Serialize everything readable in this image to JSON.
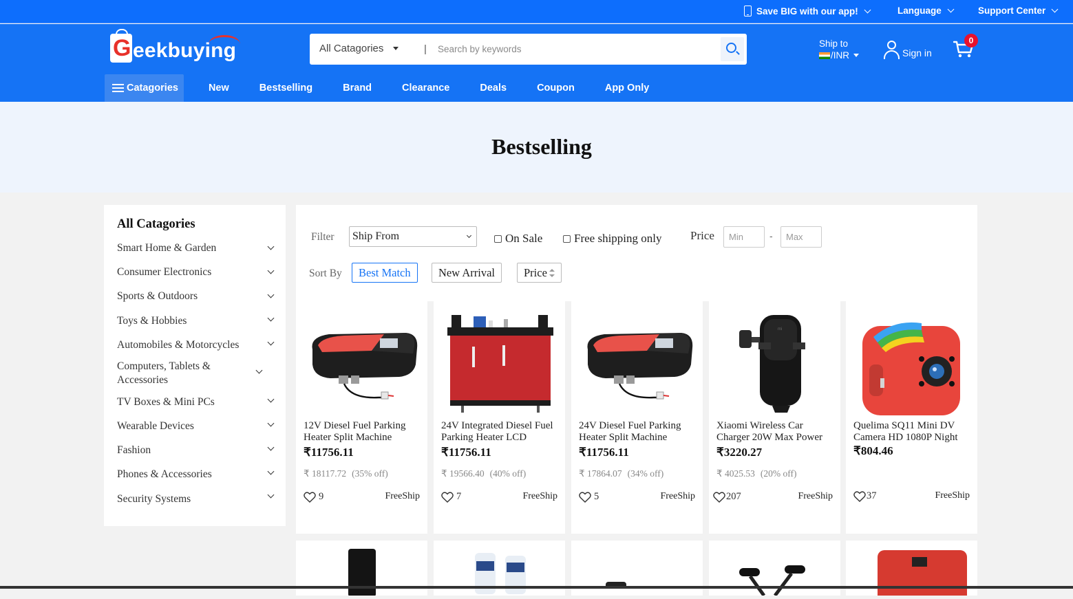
{
  "topbar": {
    "app_promo": "Save BIG with our app!",
    "language": "Language",
    "support": "Support Center"
  },
  "header": {
    "logo_g": "G",
    "logo_text": "eekbuying",
    "search": {
      "category": "All Catagories",
      "separator": "|",
      "placeholder": "Search by keywords",
      "value": ""
    },
    "ship_to": {
      "label": "Ship to",
      "currency": "/INR"
    },
    "signin": "Sign in",
    "cart_count": "0"
  },
  "nav": {
    "categories": "Catagories",
    "items": [
      "New",
      "Bestselling",
      "Brand",
      "Clearance",
      "Deals",
      "Coupon",
      "App Only"
    ]
  },
  "banner": {
    "title": "Bestselling"
  },
  "sidebar": {
    "title": "All Catagories",
    "items": [
      "Smart Home & Garden",
      "Consumer Electronics",
      "Sports & Outdoors",
      "Toys & Hobbies",
      "Automobiles & Motorcycles",
      "Computers, Tablets & Accessories",
      "TV Boxes & Mini PCs",
      "Wearable Devices",
      "Fashion",
      "Phones & Accessories",
      "Security Systems"
    ]
  },
  "filter": {
    "label": "Filter",
    "ship_from": "Ship From",
    "on_sale": "On Sale",
    "free_shipping": "Free shipping only",
    "price_label": "Price",
    "min_placeholder": "Min",
    "max_placeholder": "Max",
    "dash": "-"
  },
  "sort": {
    "label": "Sort By",
    "options": [
      "Best Match",
      "New Arrival",
      "Price"
    ],
    "active": "Best Match"
  },
  "products": [
    {
      "name": "12V Diesel Fuel Parking Heater Split Machine",
      "price": "₹11756.11",
      "old_price": "₹ 18117.72",
      "discount": "(35% off)",
      "likes": "9",
      "ship": "FreeShip"
    },
    {
      "name": "24V Integrated Diesel Fuel Parking Heater LCD",
      "price": "₹11756.11",
      "old_price": "₹ 19566.40",
      "discount": "(40% off)",
      "likes": "7",
      "ship": "FreeShip"
    },
    {
      "name": "24V Diesel Fuel Parking Heater Split Machine",
      "price": "₹11756.11",
      "old_price": "₹ 17864.07",
      "discount": "(34% off)",
      "likes": "5",
      "ship": "FreeShip"
    },
    {
      "name": "Xiaomi Wireless Car Charger 20W Max Power",
      "price": "₹3220.27",
      "old_price": "₹ 4025.53",
      "discount": "(20% off)",
      "likes": "207",
      "ship": "FreeShip"
    },
    {
      "name": "Quelima SQ11 Mini DV Camera HD 1080P Night",
      "price": "₹804.46",
      "old_price": "",
      "discount": "",
      "likes": "37",
      "ship": "FreeShip"
    }
  ],
  "colors": {
    "brand_blue": "#1573f5",
    "topbar_blue": "#0d6efd",
    "badge_red": "#e8112d",
    "logo_red": "#e8312a"
  }
}
